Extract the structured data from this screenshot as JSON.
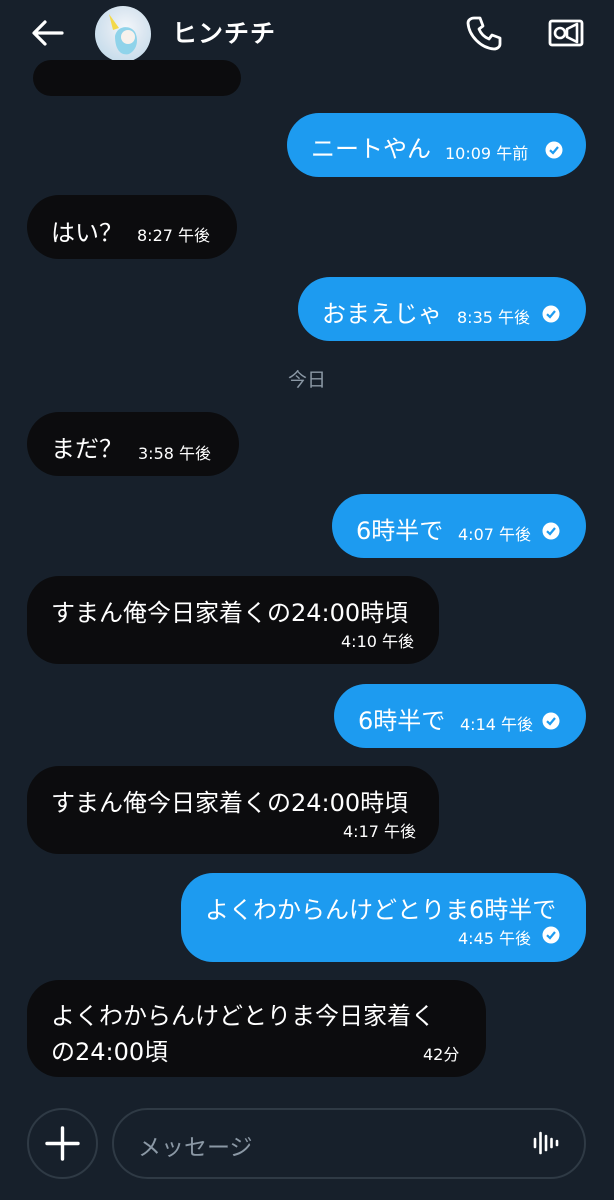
{
  "header": {
    "name": "ヒンチチ"
  },
  "date_separator": "今日",
  "messages": [
    {
      "dir": "out",
      "text": "ニートやん",
      "time": "10:09 午前"
    },
    {
      "dir": "in",
      "text": "はい？",
      "time": "8:27 午後"
    },
    {
      "dir": "out",
      "text": "おまえじゃ",
      "time": "8:35 午後"
    },
    {
      "dir": "in",
      "text": "まだ？",
      "time": "3:58 午後"
    },
    {
      "dir": "out",
      "text": "6時半で",
      "time": "4:07 午後"
    },
    {
      "dir": "in",
      "text": "すまん俺今日家着くの24:00時頃",
      "time": "4:10 午後"
    },
    {
      "dir": "out",
      "text": "6時半で",
      "time": "4:14 午後"
    },
    {
      "dir": "in",
      "text": "すまん俺今日家着くの24:00時頃",
      "time": "4:17 午後"
    },
    {
      "dir": "out",
      "text": "よくわからんけどとりま6時半で",
      "time": "4:45 午後"
    },
    {
      "dir": "in",
      "text_line1": "よくわからんけどとりま今日家着く",
      "text_line2": "の24:00頃",
      "time": "42分"
    }
  ],
  "composer": {
    "placeholder": "メッセージ"
  },
  "colors": {
    "background": "#17202b",
    "incoming": "#0c0c0e",
    "outgoing": "#1d9bf0"
  }
}
